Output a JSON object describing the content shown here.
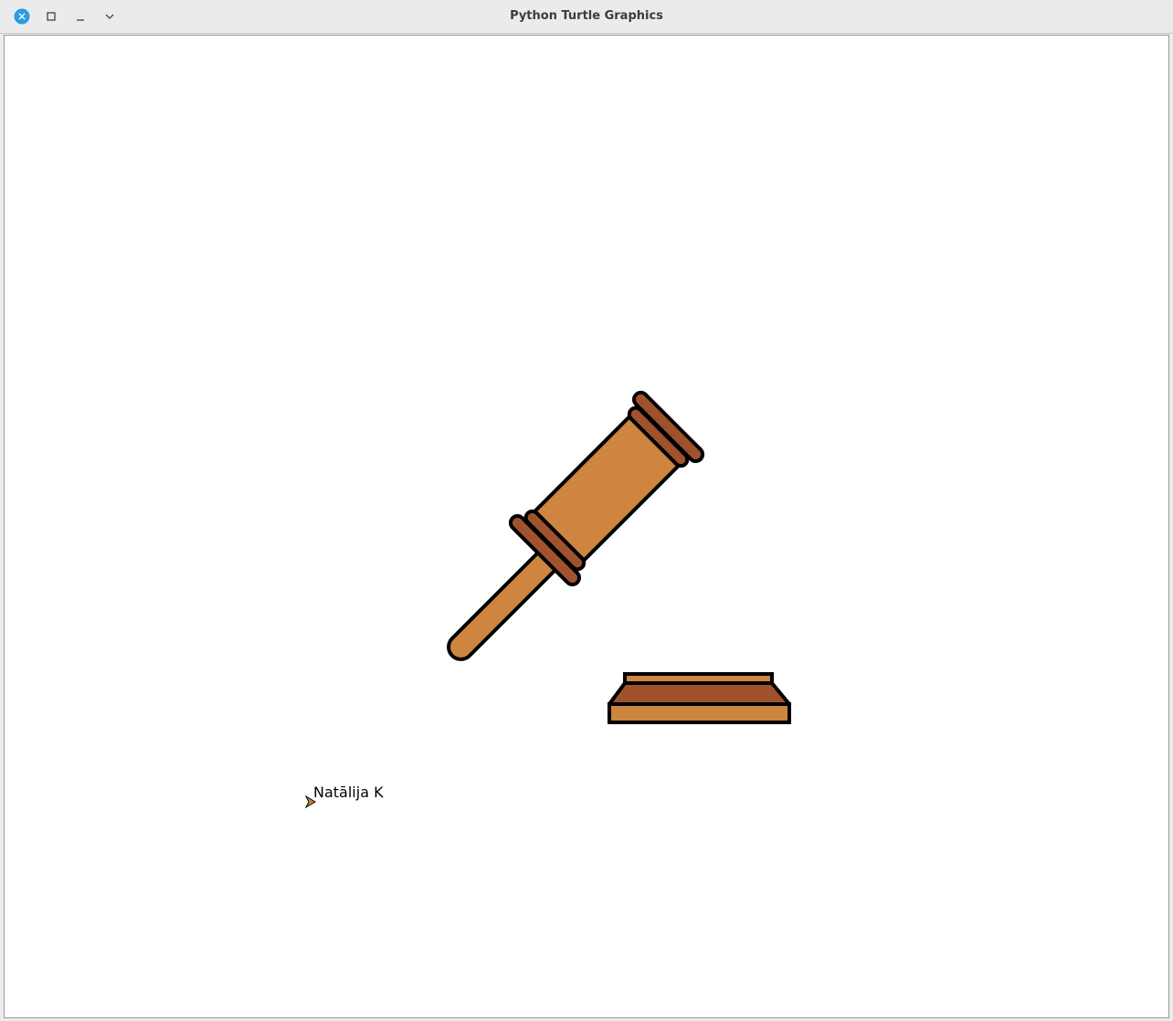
{
  "window": {
    "title": "Python Turtle Graphics",
    "controls": {
      "close": "close-icon",
      "maximize": "maximize-icon",
      "minimize": "minimize-icon",
      "menu": "chevron-down-icon"
    },
    "accent_color": "#2e9ae0"
  },
  "drawing": {
    "subject": "gavel",
    "colors": {
      "light_wood": "#cd853f",
      "dark_wood": "#a0522d",
      "outline": "#000000"
    },
    "author_text": "Natālija K",
    "turtle_cursor": "arrow-cursor-icon"
  }
}
